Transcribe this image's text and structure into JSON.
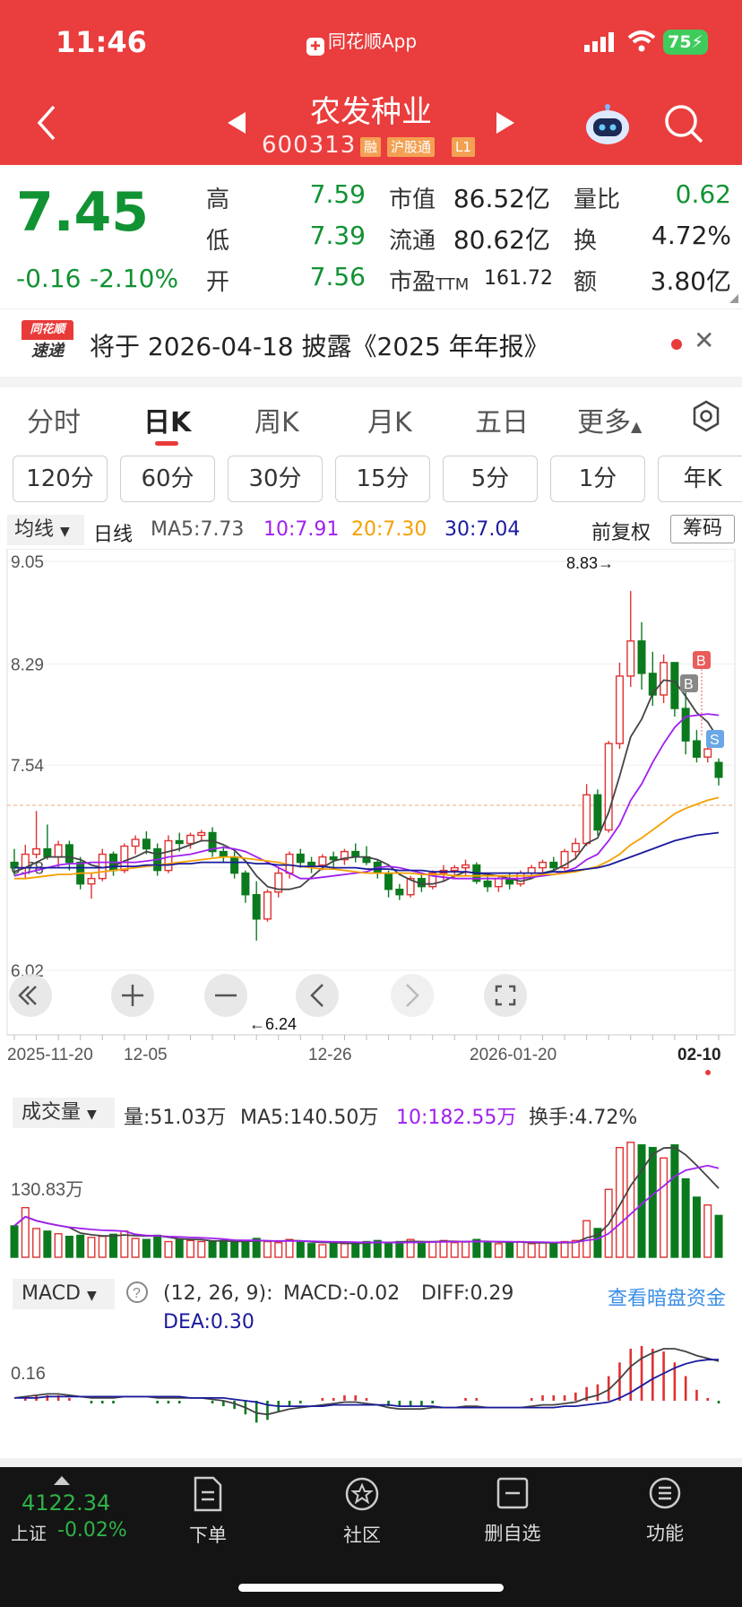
{
  "status": {
    "time": "11:46",
    "app_name": "同花顺App",
    "battery": "75"
  },
  "header": {
    "title": "农发种业",
    "code": "600313",
    "tags": [
      "融",
      "沪股通",
      "L1"
    ]
  },
  "quote": {
    "price": "7.45",
    "change": "-0.16",
    "change_pct": "-2.10%",
    "fields": [
      {
        "label": "高",
        "value": "7.59"
      },
      {
        "label": "低",
        "value": "7.39"
      },
      {
        "label": "开",
        "value": "7.56"
      },
      {
        "label": "市值",
        "value": "86.52亿"
      },
      {
        "label": "流通",
        "value": "80.62亿"
      },
      {
        "label": "市盈",
        "sup": "TTM",
        "value": "161.72"
      },
      {
        "label": "量比",
        "value": "0.62"
      },
      {
        "label": "换",
        "value": "4.72%"
      },
      {
        "label": "额",
        "value": "3.80亿"
      }
    ]
  },
  "notice": {
    "logo_top": "同花顺",
    "logo_bottom": "速递",
    "text": "将于 2026-04-18 披露《2025 年年报》"
  },
  "period_tabs": [
    "分时",
    "日K",
    "周K",
    "月K",
    "五日",
    "更多"
  ],
  "minute_buttons": [
    "120分",
    "60分",
    "30分",
    "15分",
    "5分",
    "1分",
    "年K"
  ],
  "ma_bar": {
    "selector": "均线",
    "line_type": "日线",
    "ma5": "MA5:7.73",
    "ma10": "10:7.91",
    "ma20": "20:7.30",
    "ma30": "30:7.04",
    "adjust": "前复权",
    "chips": "筹码"
  },
  "chart_data": {
    "type": "candlestick",
    "price_axis_labels": [
      "9.05",
      "8.29",
      "7.54",
      "6.78",
      "6.02"
    ],
    "x_axis_labels": [
      "2025-11-20",
      "12-05",
      "12-26",
      "2026-01-20",
      "02-10"
    ],
    "annotations": {
      "high": "8.83→",
      "low": "←6.24",
      "markers": [
        "B",
        "B",
        "S"
      ]
    },
    "candles": [
      [
        6.82,
        6.92,
        6.72,
        6.78
      ],
      [
        6.78,
        6.95,
        6.7,
        6.88
      ],
      [
        6.88,
        7.2,
        6.85,
        6.92
      ],
      [
        6.92,
        7.1,
        6.84,
        6.86
      ],
      [
        6.86,
        6.98,
        6.78,
        6.95
      ],
      [
        6.95,
        6.98,
        6.76,
        6.82
      ],
      [
        6.82,
        6.86,
        6.62,
        6.66
      ],
      [
        6.66,
        6.74,
        6.55,
        6.7
      ],
      [
        6.7,
        6.92,
        6.68,
        6.88
      ],
      [
        6.88,
        6.9,
        6.72,
        6.76
      ],
      [
        6.76,
        6.96,
        6.74,
        6.94
      ],
      [
        6.94,
        7.02,
        6.88,
        6.99
      ],
      [
        6.99,
        7.05,
        6.88,
        6.92
      ],
      [
        6.92,
        6.96,
        6.72,
        6.76
      ],
      [
        6.76,
        7.02,
        6.74,
        6.98
      ],
      [
        6.98,
        7.04,
        6.9,
        6.96
      ],
      [
        6.96,
        7.04,
        6.92,
        7.02
      ],
      [
        7.02,
        7.06,
        6.98,
        7.04
      ],
      [
        7.04,
        7.08,
        6.86,
        6.9
      ],
      [
        6.9,
        6.94,
        6.82,
        6.86
      ],
      [
        6.86,
        6.9,
        6.7,
        6.74
      ],
      [
        6.74,
        6.76,
        6.52,
        6.58
      ],
      [
        6.58,
        6.68,
        6.24,
        6.4
      ],
      [
        6.4,
        6.62,
        6.38,
        6.6
      ],
      [
        6.6,
        6.78,
        6.56,
        6.74
      ],
      [
        6.74,
        6.9,
        6.7,
        6.88
      ],
      [
        6.88,
        6.92,
        6.78,
        6.82
      ],
      [
        6.82,
        6.86,
        6.74,
        6.8
      ],
      [
        6.8,
        6.88,
        6.76,
        6.86
      ],
      [
        6.86,
        6.9,
        6.78,
        6.84
      ],
      [
        6.84,
        6.92,
        6.8,
        6.9
      ],
      [
        6.9,
        6.96,
        6.82,
        6.86
      ],
      [
        6.86,
        6.94,
        6.8,
        6.82
      ],
      [
        6.82,
        6.84,
        6.7,
        6.74
      ],
      [
        6.74,
        6.76,
        6.56,
        6.62
      ],
      [
        6.62,
        6.66,
        6.54,
        6.58
      ],
      [
        6.58,
        6.72,
        6.56,
        6.7
      ],
      [
        6.7,
        6.74,
        6.6,
        6.64
      ],
      [
        6.64,
        6.76,
        6.62,
        6.74
      ],
      [
        6.74,
        6.8,
        6.68,
        6.76
      ],
      [
        6.76,
        6.8,
        6.7,
        6.78
      ],
      [
        6.78,
        6.84,
        6.72,
        6.8
      ],
      [
        6.8,
        6.82,
        6.66,
        6.68
      ],
      [
        6.68,
        6.74,
        6.6,
        6.64
      ],
      [
        6.64,
        6.72,
        6.6,
        6.7
      ],
      [
        6.7,
        6.74,
        6.62,
        6.66
      ],
      [
        6.66,
        6.76,
        6.64,
        6.74
      ],
      [
        6.74,
        6.8,
        6.7,
        6.78
      ],
      [
        6.78,
        6.84,
        6.74,
        6.82
      ],
      [
        6.82,
        6.86,
        6.76,
        6.78
      ],
      [
        6.78,
        6.92,
        6.76,
        6.9
      ],
      [
        6.9,
        7.0,
        6.84,
        6.96
      ],
      [
        6.96,
        7.4,
        6.94,
        7.32
      ],
      [
        7.32,
        7.36,
        7.02,
        7.06
      ],
      [
        7.06,
        7.72,
        7.04,
        7.7
      ],
      [
        7.7,
        8.3,
        7.66,
        8.2
      ],
      [
        8.2,
        8.83,
        8.12,
        8.46
      ],
      [
        8.46,
        8.6,
        8.1,
        8.22
      ],
      [
        8.22,
        8.38,
        7.98,
        8.06
      ],
      [
        8.06,
        8.36,
        8.0,
        8.3
      ],
      [
        8.3,
        8.2,
        7.9,
        7.96
      ],
      [
        7.96,
        8.08,
        7.62,
        7.72
      ],
      [
        7.72,
        7.8,
        7.56,
        7.6
      ],
      [
        7.6,
        7.72,
        7.56,
        7.66
      ],
      [
        7.56,
        7.59,
        7.39,
        7.45
      ]
    ],
    "ma5": [
      6.75,
      6.78,
      6.82,
      6.86,
      6.86,
      6.86,
      6.84,
      6.8,
      6.78,
      6.79,
      6.83,
      6.86,
      6.9,
      6.88,
      6.9,
      6.92,
      6.95,
      6.98,
      6.98,
      6.95,
      6.91,
      6.83,
      6.72,
      6.64,
      6.62,
      6.62,
      6.64,
      6.71,
      6.78,
      6.83,
      6.85,
      6.86,
      6.86,
      6.84,
      6.8,
      6.73,
      6.69,
      6.66,
      6.66,
      6.68,
      6.72,
      6.75,
      6.74,
      6.73,
      6.72,
      6.7,
      6.68,
      6.7,
      6.74,
      6.76,
      6.8,
      6.85,
      6.96,
      7.0,
      7.19,
      7.46,
      7.75,
      7.88,
      8.07,
      8.17,
      8.16,
      8.05,
      7.93,
      7.86,
      7.73
    ],
    "ma10": [
      6.72,
      6.74,
      6.76,
      6.78,
      6.8,
      6.81,
      6.81,
      6.82,
      6.82,
      6.82,
      6.82,
      6.82,
      6.83,
      6.84,
      6.86,
      6.87,
      6.88,
      6.9,
      6.92,
      6.93,
      6.92,
      6.9,
      6.86,
      6.82,
      6.78,
      6.74,
      6.7,
      6.7,
      6.71,
      6.72,
      6.73,
      6.74,
      6.75,
      6.78,
      6.79,
      6.78,
      6.76,
      6.74,
      6.72,
      6.71,
      6.7,
      6.7,
      6.7,
      6.7,
      6.7,
      6.7,
      6.7,
      6.71,
      6.72,
      6.73,
      6.75,
      6.78,
      6.84,
      6.88,
      6.98,
      7.1,
      7.28,
      7.4,
      7.56,
      7.7,
      7.82,
      7.9,
      7.91,
      7.92,
      7.91
    ],
    "ma20": [
      6.7,
      6.7,
      6.71,
      6.72,
      6.73,
      6.73,
      6.74,
      6.74,
      6.75,
      6.76,
      6.77,
      6.78,
      6.79,
      6.8,
      6.81,
      6.82,
      6.83,
      6.84,
      6.85,
      6.86,
      6.86,
      6.85,
      6.84,
      6.83,
      6.82,
      6.8,
      6.79,
      6.78,
      6.77,
      6.77,
      6.76,
      6.75,
      6.74,
      6.74,
      6.74,
      6.74,
      6.74,
      6.73,
      6.73,
      6.73,
      6.72,
      6.72,
      6.72,
      6.72,
      6.72,
      6.72,
      6.72,
      6.72,
      6.73,
      6.73,
      6.74,
      6.75,
      6.77,
      6.79,
      6.83,
      6.88,
      6.95,
      7.0,
      7.06,
      7.12,
      7.18,
      7.22,
      7.25,
      7.28,
      7.3
    ],
    "ma30": [
      6.78,
      6.78,
      6.78,
      6.78,
      6.78,
      6.78,
      6.78,
      6.78,
      6.78,
      6.79,
      6.79,
      6.79,
      6.8,
      6.8,
      6.8,
      6.81,
      6.81,
      6.82,
      6.82,
      6.82,
      6.82,
      6.82,
      6.81,
      6.81,
      6.8,
      6.8,
      6.79,
      6.79,
      6.79,
      6.78,
      6.78,
      6.78,
      6.77,
      6.77,
      6.77,
      6.76,
      6.76,
      6.76,
      6.75,
      6.75,
      6.75,
      6.75,
      6.74,
      6.74,
      6.74,
      6.74,
      6.74,
      6.74,
      6.74,
      6.75,
      6.75,
      6.76,
      6.77,
      6.78,
      6.8,
      6.83,
      6.86,
      6.89,
      6.92,
      6.95,
      6.98,
      7.0,
      7.02,
      7.03,
      7.04
    ],
    "volume": [
      60,
      95,
      55,
      50,
      45,
      40,
      42,
      38,
      40,
      44,
      50,
      36,
      34,
      42,
      30,
      34,
      32,
      30,
      30,
      32,
      28,
      32,
      36,
      30,
      28,
      34,
      30,
      26,
      24,
      28,
      26,
      28,
      30,
      32,
      26,
      30,
      34,
      28,
      30,
      32,
      28,
      30,
      34,
      28,
      26,
      28,
      30,
      26,
      28,
      26,
      30,
      32,
      70,
      55,
      130,
      210,
      220,
      215,
      210,
      190,
      215,
      150,
      115,
      100,
      80
    ],
    "macd": {
      "dif": [
        0.02,
        0.03,
        0.04,
        0.05,
        0.05,
        0.04,
        0.03,
        0.02,
        0.02,
        0.02,
        0.03,
        0.03,
        0.03,
        0.02,
        0.02,
        0.02,
        0.02,
        0.02,
        0.01,
        0.0,
        -0.02,
        -0.05,
        -0.09,
        -0.1,
        -0.08,
        -0.06,
        -0.05,
        -0.04,
        -0.03,
        -0.02,
        -0.01,
        -0.01,
        -0.02,
        -0.03,
        -0.05,
        -0.06,
        -0.06,
        -0.06,
        -0.05,
        -0.05,
        -0.05,
        -0.04,
        -0.04,
        -0.05,
        -0.05,
        -0.05,
        -0.05,
        -0.04,
        -0.03,
        -0.03,
        -0.02,
        -0.01,
        0.02,
        0.04,
        0.08,
        0.16,
        0.25,
        0.31,
        0.35,
        0.38,
        0.38,
        0.36,
        0.33,
        0.31,
        0.29
      ],
      "dea": [
        0.02,
        0.02,
        0.02,
        0.03,
        0.03,
        0.03,
        0.03,
        0.03,
        0.03,
        0.03,
        0.03,
        0.03,
        0.03,
        0.03,
        0.03,
        0.03,
        0.02,
        0.02,
        0.02,
        0.02,
        0.01,
        0.0,
        -0.01,
        -0.03,
        -0.04,
        -0.04,
        -0.04,
        -0.04,
        -0.04,
        -0.03,
        -0.03,
        -0.03,
        -0.03,
        -0.03,
        -0.03,
        -0.04,
        -0.04,
        -0.04,
        -0.04,
        -0.05,
        -0.05,
        -0.05,
        -0.05,
        -0.05,
        -0.05,
        -0.05,
        -0.05,
        -0.05,
        -0.05,
        -0.05,
        -0.04,
        -0.04,
        -0.03,
        -0.02,
        -0.01,
        0.02,
        0.06,
        0.11,
        0.16,
        0.2,
        0.24,
        0.27,
        0.29,
        0.3,
        0.3
      ],
      "axis_label": "0.16"
    }
  },
  "volume_bar": {
    "selector": "成交量",
    "vol": "量:51.03万",
    "ma5": "MA5:140.50万",
    "ma10": "10:182.55万",
    "turnover": "换手:4.72%",
    "axis_label": "130.83万"
  },
  "macd_bar": {
    "selector": "MACD",
    "params": "(12, 26, 9):",
    "macd": "MACD:-0.02",
    "diff": "DIFF:0.29",
    "dea": "DEA:0.30",
    "link": "查看暗盘资金"
  },
  "bottom": {
    "index_value": "4122.34",
    "index_name": "上证",
    "index_pct": "-0.02%",
    "nav": [
      "下单",
      "社区",
      "删自选",
      "功能"
    ]
  },
  "colors": {
    "up": "#e03131",
    "down": "#0b7a1e",
    "ma5": "#444444",
    "ma10": "#a020f0",
    "ma20": "#f5a000",
    "ma30": "#1a1a9e",
    "header": "#ea3d3d"
  }
}
